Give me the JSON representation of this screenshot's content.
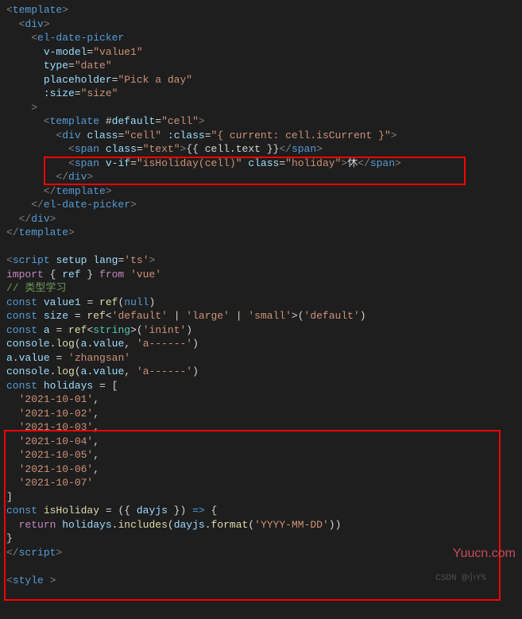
{
  "watermark": "CSDN @小Y%",
  "branding": "Yuucn.com",
  "code": {
    "l1_a": "<",
    "l1_b": "template",
    "l1_c": ">",
    "l2_a": "  <",
    "l2_b": "div",
    "l2_c": ">",
    "l3_a": "    <",
    "l3_b": "el-date-picker",
    "l4_a": "      ",
    "l4_b": "v-model",
    "l4_c": "=",
    "l4_d": "\"value1\"",
    "l5_a": "      ",
    "l5_b": "type",
    "l5_c": "=",
    "l5_d": "\"date\"",
    "l6_a": "      ",
    "l6_b": "placeholder",
    "l6_c": "=",
    "l6_d": "\"Pick a day\"",
    "l7_a": "      ",
    "l7_b": ":size",
    "l7_c": "=",
    "l7_d": "\"size\"",
    "l8_a": "    >",
    "l9_a": "      <",
    "l9_b": "template",
    "l9_c": " #",
    "l9_d": "default",
    "l9_e": "=",
    "l9_f": "\"cell\"",
    "l9_g": ">",
    "l10_a": "        <",
    "l10_b": "div",
    "l10_c": " ",
    "l10_d": "class",
    "l10_e": "=",
    "l10_f": "\"cell\"",
    "l10_g": " ",
    "l10_h": ":class",
    "l10_i": "=",
    "l10_j": "\"{ current: cell.isCurrent }\"",
    "l10_k": ">",
    "l11_a": "          <",
    "l11_b": "span",
    "l11_c": " ",
    "l11_d": "class",
    "l11_e": "=",
    "l11_f": "\"text\"",
    "l11_g": ">",
    "l11_h": "{{ cell.text }}",
    "l11_i": "</",
    "l11_j": "span",
    "l11_k": ">",
    "l12_a": "          <",
    "l12_b": "span",
    "l12_c": " ",
    "l12_d": "v-if",
    "l12_e": "=",
    "l12_f": "\"isHoliday(cell)\"",
    "l12_g": " ",
    "l12_h": "class",
    "l12_i": "=",
    "l12_j": "\"holiday\"",
    "l12_k": ">",
    "l12_l": "休",
    "l12_m": "</",
    "l12_n": "span",
    "l12_o": ">",
    "l13_a": "        </",
    "l13_b": "div",
    "l13_c": ">",
    "l14_a": "      </",
    "l14_b": "template",
    "l14_c": ">",
    "l15_a": "    </",
    "l15_b": "el-date-picker",
    "l15_c": ">",
    "l16_a": "  </",
    "l16_b": "div",
    "l16_c": ">",
    "l17_a": "</",
    "l17_b": "template",
    "l17_c": ">",
    "l18": " ",
    "l19_a": "<",
    "l19_b": "script",
    "l19_c": " ",
    "l19_d": "setup",
    "l19_e": " ",
    "l19_f": "lang",
    "l19_g": "=",
    "l19_h": "'ts'",
    "l19_i": ">",
    "l20_a": "import",
    "l20_b": " { ",
    "l20_c": "ref",
    "l20_d": " } ",
    "l20_e": "from",
    "l20_f": " ",
    "l20_g": "'vue'",
    "l21": "// 类型学习",
    "l22_a": "const",
    "l22_b": " ",
    "l22_c": "value1",
    "l22_d": " = ",
    "l22_e": "ref",
    "l22_f": "(",
    "l22_g": "null",
    "l22_h": ")",
    "l23_a": "const",
    "l23_b": " ",
    "l23_c": "size",
    "l23_d": " = ",
    "l23_e": "ref",
    "l23_f": "<",
    "l23_g": "'default'",
    "l23_h": " | ",
    "l23_i": "'large'",
    "l23_j": " | ",
    "l23_k": "'small'",
    "l23_l": ">(",
    "l23_m": "'default'",
    "l23_n": ")",
    "l24_a": "const",
    "l24_b": " ",
    "l24_c": "a",
    "l24_d": " = ",
    "l24_e": "ref",
    "l24_f": "<",
    "l24_g": "string",
    "l24_h": ">(",
    "l24_i": "'inint'",
    "l24_j": ")",
    "l25_a": "console",
    "l25_b": ".",
    "l25_c": "log",
    "l25_d": "(",
    "l25_e": "a",
    "l25_f": ".",
    "l25_g": "value",
    "l25_h": ", ",
    "l25_i": "'a------'",
    "l25_j": ")",
    "l26_a": "a",
    "l26_b": ".",
    "l26_c": "value",
    "l26_d": " = ",
    "l26_e": "'zhangsan'",
    "l27_a": "console",
    "l27_b": ".",
    "l27_c": "log",
    "l27_d": "(",
    "l27_e": "a",
    "l27_f": ".",
    "l27_g": "value",
    "l27_h": ", ",
    "l27_i": "'a------'",
    "l27_j": ")",
    "l28_a": "const",
    "l28_b": " ",
    "l28_c": "holidays",
    "l28_d": " = [",
    "l29_a": "  ",
    "l29_b": "'2021-10-01'",
    "l29_c": ",",
    "l30_a": "  ",
    "l30_b": "'2021-10-02'",
    "l30_c": ",",
    "l31_a": "  ",
    "l31_b": "'2021-10-03'",
    "l31_c": ",",
    "l32_a": "  ",
    "l32_b": "'2021-10-04'",
    "l32_c": ",",
    "l33_a": "  ",
    "l33_b": "'2021-10-05'",
    "l33_c": ",",
    "l34_a": "  ",
    "l34_b": "'2021-10-06'",
    "l34_c": ",",
    "l35_a": "  ",
    "l35_b": "'2021-10-07'",
    "l36": "]",
    "l37_a": "const",
    "l37_b": " ",
    "l37_c": "isHoliday",
    "l37_d": " = ({ ",
    "l37_e": "dayjs",
    "l37_f": " }) ",
    "l37_g": "=>",
    "l37_h": " {",
    "l38_a": "  ",
    "l38_b": "return",
    "l38_c": " ",
    "l38_d": "holidays",
    "l38_e": ".",
    "l38_f": "includes",
    "l38_g": "(",
    "l38_h": "dayjs",
    "l38_i": ".",
    "l38_j": "format",
    "l38_k": "(",
    "l38_l": "'YYYY-MM-DD'",
    "l38_m": "))",
    "l39": "}",
    "l40_a": "</",
    "l40_b": "script",
    "l40_c": ">",
    "l41": " ",
    "l42_a": "<",
    "l42_b": "style",
    "l42_c": " >"
  }
}
